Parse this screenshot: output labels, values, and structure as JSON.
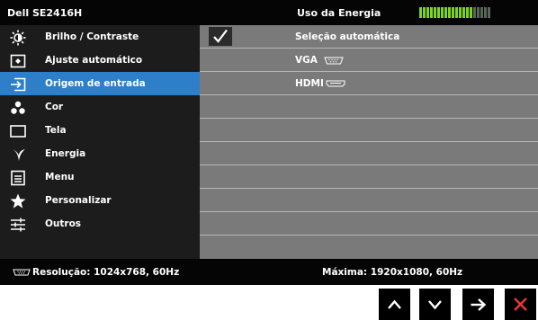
{
  "header": {
    "model": "Dell SE2416H",
    "energy_label": "Uso da Energia",
    "energy_level_active": 15,
    "energy_level_total": 20,
    "energy_color": "#7ed321"
  },
  "sidebar": {
    "items": [
      {
        "label": "Brilho / Contraste",
        "icon": "brightness-icon"
      },
      {
        "label": "Ajuste automático",
        "icon": "auto-adjust-icon"
      },
      {
        "label": "Origem de entrada",
        "icon": "input-source-icon",
        "selected": true
      },
      {
        "label": "Cor",
        "icon": "color-icon"
      },
      {
        "label": "Tela",
        "icon": "display-icon"
      },
      {
        "label": "Energia",
        "icon": "energy-icon"
      },
      {
        "label": "Menu",
        "icon": "menu-icon"
      },
      {
        "label": "Personalizar",
        "icon": "star-icon"
      },
      {
        "label": "Outros",
        "icon": "sliders-icon"
      }
    ],
    "selected_color": "#2d7fc9"
  },
  "content": {
    "rows": [
      {
        "label": "Seleção automática",
        "checked": true
      },
      {
        "label": "VGA",
        "connector": "vga-connector-icon"
      },
      {
        "label": "HDMI",
        "connector": "hdmi-connector-icon"
      }
    ]
  },
  "footer": {
    "resolution": "Resolução: 1024x768, 60Hz",
    "maximum": "Máxima: 1920x1080, 60Hz"
  },
  "nav": {
    "buttons": [
      "up-arrow-icon",
      "down-arrow-icon",
      "right-arrow-icon",
      "close-icon"
    ],
    "close_color": "#e53935"
  }
}
